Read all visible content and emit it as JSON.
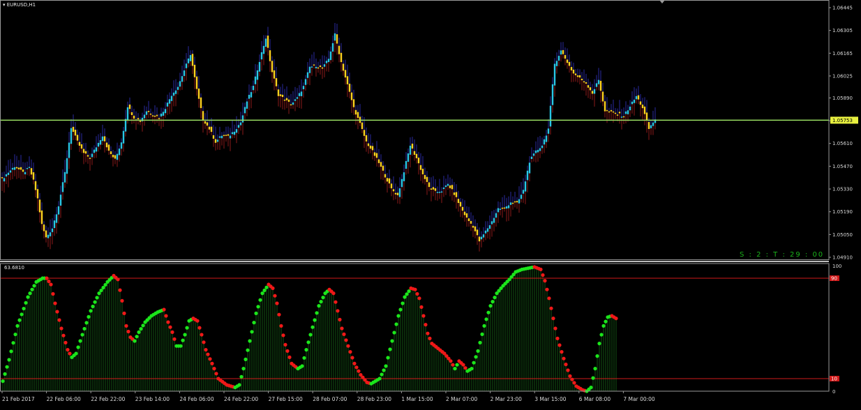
{
  "window": {
    "symbol_label": "EURUSD,H1",
    "indicator_value_label": "63.6810",
    "timer_label": "S : 2 : T : 29 : 00"
  },
  "chart_data": [
    {
      "type": "candlestick",
      "title": "EURUSD,H1",
      "price_ticks": [
        1.06445,
        1.06305,
        1.06165,
        1.06025,
        1.0589,
        1.0575,
        1.0561,
        1.0547,
        1.0533,
        1.0519,
        1.0505,
        1.0491
      ],
      "price_tick_labels": [
        "1.06445",
        "1.06305",
        "1.06165",
        "1.06025",
        "1.05890",
        "1.05753",
        "1.05610",
        "1.05470",
        "1.05330",
        "1.05190",
        "1.05050",
        "1.04910"
      ],
      "ylim": [
        1.0491,
        1.06445
      ],
      "current_price": 1.05753,
      "current_price_label": "1.05753",
      "colors": {
        "bull": "#29c7e6",
        "bear": "#ffd21f",
        "hline": "#9ae063",
        "wick_up": "#2a2aa0",
        "wick_down": "#8b1a1a"
      },
      "price_path": [
        [
          0,
          1.0539
        ],
        [
          2,
          1.0542
        ],
        [
          6,
          1.0547
        ],
        [
          10,
          1.0543
        ],
        [
          13,
          1.0546
        ],
        [
          15,
          1.0538
        ],
        [
          17,
          1.0527
        ],
        [
          19,
          1.0511
        ],
        [
          21,
          1.0503
        ],
        [
          24,
          1.0509
        ],
        [
          27,
          1.0523
        ],
        [
          30,
          1.0543
        ],
        [
          33,
          1.0571
        ],
        [
          36,
          1.0562
        ],
        [
          39,
          1.0555
        ],
        [
          42,
          1.0552
        ],
        [
          45,
          1.0559
        ],
        [
          48,
          1.0566
        ],
        [
          51,
          1.0556
        ],
        [
          54,
          1.0551
        ],
        [
          57,
          1.0562
        ],
        [
          60,
          1.0584
        ],
        [
          63,
          1.0577
        ],
        [
          66,
          1.0575
        ],
        [
          69,
          1.0581
        ],
        [
          72,
          1.0579
        ],
        [
          75,
          1.0577
        ],
        [
          78,
          1.0583
        ],
        [
          81,
          1.0591
        ],
        [
          84,
          1.0596
        ],
        [
          87,
          1.0606
        ],
        [
          90,
          1.0616
        ],
        [
          93,
          1.0594
        ],
        [
          96,
          1.0576
        ],
        [
          99,
          1.057
        ],
        [
          102,
          1.0562
        ],
        [
          105,
          1.0566
        ],
        [
          108,
          1.0565
        ],
        [
          111,
          1.0569
        ],
        [
          114,
          1.0574
        ],
        [
          117,
          1.0587
        ],
        [
          120,
          1.0596
        ],
        [
          123,
          1.0612
        ],
        [
          126,
          1.0626
        ],
        [
          129,
          1.0605
        ],
        [
          132,
          1.0591
        ],
        [
          135,
          1.0588
        ],
        [
          138,
          1.0585
        ],
        [
          141,
          1.0589
        ],
        [
          144,
          1.0596
        ],
        [
          147,
          1.0608
        ],
        [
          150,
          1.0609
        ],
        [
          153,
          1.0607
        ],
        [
          156,
          1.0613
        ],
        [
          159,
          1.0628
        ],
        [
          162,
          1.0611
        ],
        [
          165,
          1.0597
        ],
        [
          168,
          1.0583
        ],
        [
          171,
          1.0573
        ],
        [
          174,
          1.0562
        ],
        [
          177,
          1.0556
        ],
        [
          180,
          1.0549
        ],
        [
          183,
          1.0541
        ],
        [
          186,
          1.0533
        ],
        [
          189,
          1.0529
        ],
        [
          192,
          1.0544
        ],
        [
          195,
          1.056
        ],
        [
          198,
          1.0552
        ],
        [
          201,
          1.0542
        ],
        [
          204,
          1.0534
        ],
        [
          207,
          1.0531
        ],
        [
          210,
          1.0532
        ],
        [
          213,
          1.0536
        ],
        [
          216,
          1.053
        ],
        [
          219,
          1.0522
        ],
        [
          222,
          1.0515
        ],
        [
          225,
          1.051
        ],
        [
          228,
          1.0501
        ],
        [
          231,
          1.0507
        ],
        [
          234,
          1.0513
        ],
        [
          237,
          1.0521
        ],
        [
          240,
          1.0521
        ],
        [
          243,
          1.0525
        ],
        [
          246,
          1.0524
        ],
        [
          249,
          1.0532
        ],
        [
          252,
          1.055
        ],
        [
          255,
          1.0556
        ],
        [
          258,
          1.056
        ],
        [
          261,
          1.057
        ],
        [
          264,
          1.061
        ],
        [
          267,
          1.0618
        ],
        [
          270,
          1.0611
        ],
        [
          273,
          1.0604
        ],
        [
          276,
          1.0601
        ],
        [
          279,
          1.0598
        ],
        [
          282,
          1.0592
        ],
        [
          285,
          1.06
        ],
        [
          288,
          1.0581
        ],
        [
          291,
          1.058
        ],
        [
          294,
          1.0579
        ],
        [
          297,
          1.0578
        ],
        [
          300,
          1.0584
        ],
        [
          303,
          1.059
        ],
        [
          306,
          1.0583
        ],
        [
          309,
          1.057
        ],
        [
          312,
          1.0576
        ]
      ]
    },
    {
      "type": "area",
      "title": "63.6810",
      "ylim": [
        0,
        100
      ],
      "axis_tick_labels": [
        "100",
        "90",
        "10",
        "0"
      ],
      "level_lines": [
        90,
        10
      ],
      "colors": {
        "rising": "#1be61b",
        "falling": "#f01818",
        "fill": "#0f3d0f",
        "level": "#d01a1a"
      },
      "oscillator_path": [
        [
          0,
          8
        ],
        [
          3,
          25
        ],
        [
          7,
          52
        ],
        [
          12,
          75
        ],
        [
          16,
          87
        ],
        [
          19,
          90
        ],
        [
          21,
          90
        ],
        [
          23,
          85
        ],
        [
          25,
          70
        ],
        [
          28,
          50
        ],
        [
          31,
          33
        ],
        [
          33,
          27
        ],
        [
          35,
          30
        ],
        [
          38,
          45
        ],
        [
          42,
          64
        ],
        [
          46,
          78
        ],
        [
          50,
          87
        ],
        [
          53,
          92
        ],
        [
          55,
          89
        ],
        [
          57,
          72
        ],
        [
          59,
          52
        ],
        [
          61,
          43
        ],
        [
          63,
          40
        ],
        [
          65,
          47
        ],
        [
          68,
          55
        ],
        [
          71,
          60
        ],
        [
          74,
          63
        ],
        [
          77,
          65
        ],
        [
          79,
          55
        ],
        [
          81,
          47
        ],
        [
          83,
          36
        ],
        [
          85,
          36
        ],
        [
          87,
          45
        ],
        [
          89,
          56
        ],
        [
          91,
          58
        ],
        [
          93,
          56
        ],
        [
          95,
          45
        ],
        [
          97,
          33
        ],
        [
          100,
          22
        ],
        [
          103,
          10
        ],
        [
          107,
          5
        ],
        [
          111,
          3
        ],
        [
          113,
          5
        ],
        [
          115,
          18
        ],
        [
          118,
          40
        ],
        [
          121,
          62
        ],
        [
          124,
          78
        ],
        [
          127,
          85
        ],
        [
          129,
          82
        ],
        [
          131,
          70
        ],
        [
          133,
          52
        ],
        [
          135,
          37
        ],
        [
          138,
          22
        ],
        [
          141,
          18
        ],
        [
          143,
          20
        ],
        [
          145,
          33
        ],
        [
          148,
          51
        ],
        [
          151,
          68
        ],
        [
          154,
          78
        ],
        [
          156,
          81
        ],
        [
          158,
          78
        ],
        [
          160,
          64
        ],
        [
          162,
          50
        ],
        [
          165,
          36
        ],
        [
          168,
          22
        ],
        [
          171,
          13
        ],
        [
          174,
          7
        ],
        [
          176,
          6
        ],
        [
          178,
          8
        ],
        [
          180,
          10
        ],
        [
          183,
          20
        ],
        [
          186,
          40
        ],
        [
          189,
          60
        ],
        [
          192,
          75
        ],
        [
          195,
          82
        ],
        [
          197,
          81
        ],
        [
          199,
          74
        ],
        [
          201,
          60
        ],
        [
          203,
          46
        ],
        [
          205,
          38
        ],
        [
          208,
          34
        ],
        [
          211,
          30
        ],
        [
          214,
          24
        ],
        [
          216,
          18
        ],
        [
          218,
          24
        ],
        [
          220,
          21
        ],
        [
          222,
          16
        ],
        [
          224,
          18
        ],
        [
          227,
          32
        ],
        [
          230,
          52
        ],
        [
          233,
          68
        ],
        [
          236,
          78
        ],
        [
          239,
          84
        ],
        [
          242,
          89
        ],
        [
          245,
          95
        ],
        [
          248,
          97
        ],
        [
          251,
          98
        ],
        [
          254,
          99
        ],
        [
          257,
          97
        ],
        [
          259,
          88
        ],
        [
          261,
          74
        ],
        [
          263,
          58
        ],
        [
          265,
          42
        ],
        [
          268,
          26
        ],
        [
          271,
          12
        ],
        [
          274,
          4
        ],
        [
          277,
          1
        ],
        [
          279,
          0
        ],
        [
          281,
          3
        ],
        [
          283,
          18
        ],
        [
          285,
          38
        ],
        [
          287,
          52
        ],
        [
          289,
          59
        ],
        [
          291,
          60
        ],
        [
          293,
          58
        ]
      ]
    }
  ],
  "time_axis": {
    "labels": [
      "21 Feb 2017",
      "22 Feb 06:00",
      "22 Feb 22:00",
      "23 Feb 14:00",
      "24 Feb 06:00",
      "24 Feb 22:00",
      "27 Feb 15:00",
      "28 Feb 07:00",
      "28 Feb 23:00",
      "1 Mar 15:00",
      "2 Mar 07:00",
      "2 Mar 23:00",
      "3 Mar 15:00",
      "6 Mar 08:00",
      "7 Mar 00:00"
    ]
  }
}
